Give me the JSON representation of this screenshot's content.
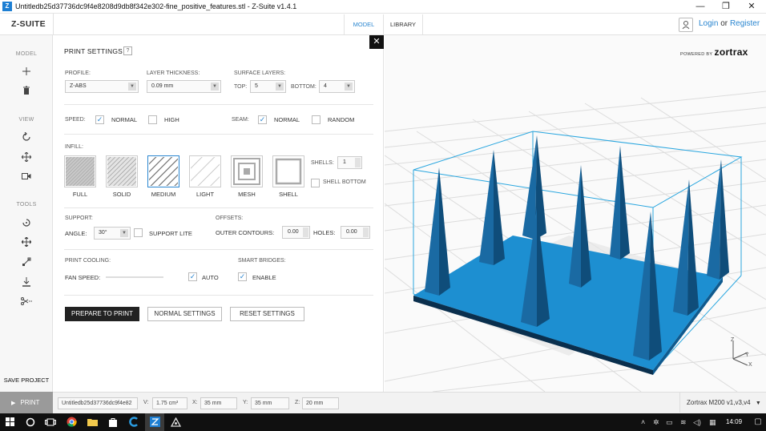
{
  "window": {
    "title": "Untitledb25d37736dc9f4e8208d9db8f342e302-fine_positive_features.stl - Z-Suite v1.4.1",
    "app_icon_letter": "Z",
    "minimize": "—",
    "restore": "❐",
    "close": "✕"
  },
  "header": {
    "logo": "Z-SUITE",
    "tabs": [
      "MODEL",
      "LIBRARY"
    ],
    "login": "Login",
    "or": "or",
    "register": "Register"
  },
  "sidebar": {
    "model_heading": "MODEL",
    "view_heading": "VIEW",
    "tools_heading": "TOOLS",
    "model_icons": [
      "add-icon",
      "trash-icon"
    ],
    "view_icons": [
      "rotate-view-icon",
      "move-view-icon",
      "camera-icon"
    ],
    "tool_icons": [
      "rotate-tool-icon",
      "move-tool-icon",
      "scale-tool-icon",
      "place-on-bed-icon",
      "cut-icon"
    ],
    "save_project": "SAVE PROJECT",
    "print": "PRINT"
  },
  "print_settings": {
    "title": "PRINT SETTINGS",
    "help": "?",
    "profile_label": "PROFILE:",
    "profile_value": "Z-ABS",
    "layer_thickness_label": "LAYER THICKNESS:",
    "layer_thickness_value": "0.09 mm",
    "surface_layers_label": "SURFACE LAYERS:",
    "top_label": "TOP:",
    "top_value": "5",
    "bottom_label": "BOTTOM:",
    "bottom_value": "4",
    "speed_label": "SPEED:",
    "speed_normal": "NORMAL",
    "speed_high": "HIGH",
    "speed_normal_checked": true,
    "speed_high_checked": false,
    "seam_label": "SEAM:",
    "seam_normal": "NORMAL",
    "seam_random": "RANDOM",
    "seam_normal_checked": true,
    "seam_random_checked": false,
    "infill_label": "INFILL:",
    "infill_options": [
      "FULL",
      "SOLID",
      "MEDIUM",
      "LIGHT",
      "MESH",
      "SHELL"
    ],
    "infill_selected": "MEDIUM",
    "shells_label": "SHELLS:",
    "shells_value": "1",
    "shell_bottom": "SHELL BOTTOM",
    "support_label": "SUPPORT:",
    "angle_label": "ANGLE:",
    "angle_value": "30°",
    "support_lite": "SUPPORT LITE",
    "offsets_label": "OFFSETS:",
    "outer_contours_label": "OUTER CONTOURS:",
    "outer_contours_value": "0.00",
    "holes_label": "HOLES:",
    "holes_value": "0.00",
    "print_cooling_label": "PRINT COOLING:",
    "fan_speed_label": "FAN SPEED:",
    "auto_label": "AUTO",
    "auto_checked": true,
    "smart_bridges_label": "SMART BRIDGES:",
    "enable_label": "ENABLE",
    "enable_checked": true,
    "prepare_button": "PREPARE TO PRINT",
    "normal_button": "NORMAL SETTINGS",
    "reset_button": "RESET SETTINGS",
    "close": "✕"
  },
  "viewport": {
    "powered_by": "POWERED BY",
    "brand": "zortrax",
    "model_color": "#1d8fd1",
    "axis_x": "X",
    "axis_y": "Y",
    "axis_z": "Z"
  },
  "status": {
    "filename": "Untitledb25d37736dc9f4e82",
    "v_label": "V:",
    "v_value": "1.75 cm³",
    "x_label": "X:",
    "x_value": "35 mm",
    "y_label": "Y:",
    "y_value": "35 mm",
    "z_label": "Z:",
    "z_value": "20 mm",
    "printer": "Zortrax M200 v1,v3,v4",
    "printer_arrow": "▼"
  },
  "taskbar": {
    "time": "14:09",
    "start_icon": "windows-start-icon"
  }
}
